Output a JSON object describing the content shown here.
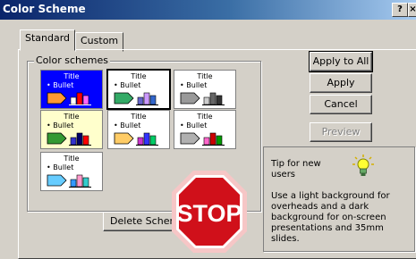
{
  "window": {
    "title": "Color Scheme",
    "help_label": "?",
    "close_label": "×"
  },
  "tabs": [
    {
      "label": "Standard"
    },
    {
      "label": "Custom"
    }
  ],
  "color_schemes": {
    "label": "Color schemes",
    "tiles": [
      {
        "title": "Title",
        "bullet": "• Bullet",
        "background": "#0000ff",
        "text_color": "#ffffff",
        "colors": [
          "#ff9933",
          "#ffffff",
          "#ff0000",
          "#ff66ff"
        ]
      },
      {
        "title": "Title",
        "bullet": "• Bullet",
        "background": "#ffffff",
        "text_color": "#000000",
        "colors": [
          "#33aa66",
          "#6666cc",
          "#cc99ff",
          "#3366cc"
        ]
      },
      {
        "title": "Title",
        "bullet": "• Bullet",
        "background": "#ffffff",
        "text_color": "#000000",
        "colors": [
          "#999999",
          "#cccccc",
          "#666666",
          "#333333"
        ]
      },
      {
        "title": "Title",
        "bullet": "• Bullet",
        "background": "#ffffcc",
        "text_color": "#000000",
        "colors": [
          "#339933",
          "#3333cc",
          "#000066",
          "#ff0000"
        ]
      },
      {
        "title": "Title",
        "bullet": "• Bullet",
        "background": "#ffffff",
        "text_color": "#000000",
        "colors": [
          "#ffcc66",
          "#cc33cc",
          "#3333ff",
          "#00cc66"
        ]
      },
      {
        "title": "Title",
        "bullet": "• Bullet",
        "background": "#ffffff",
        "text_color": "#000000",
        "colors": [
          "#b0b0b0",
          "#ff66cc",
          "#cc0000",
          "#009900"
        ]
      },
      {
        "title": "Title",
        "bullet": "• Bullet",
        "background": "#ffffff",
        "text_color": "#000000",
        "colors": [
          "#66ccff",
          "#3399ff",
          "#ff99cc",
          "#33cccc"
        ]
      }
    ]
  },
  "buttons": {
    "apply_all": "Apply to All",
    "apply": "Apply",
    "cancel": "Cancel",
    "preview": "Preview",
    "delete_scheme": "Delete Scheme"
  },
  "tip": {
    "title": "Tip for new users",
    "text": "Use a light background for overheads and a dark background for on-screen presentations and 35mm slides."
  },
  "stop_sign": {
    "text": "STOP",
    "color": "#d0101a"
  }
}
